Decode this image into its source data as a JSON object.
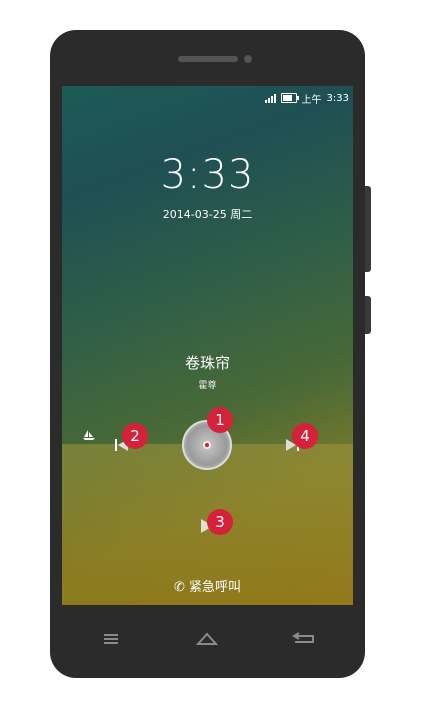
{
  "status_bar": {
    "time_period": "上午",
    "time": "3:33"
  },
  "lockscreen": {
    "clock": "3:33",
    "date": "2014-03-25 周二"
  },
  "music": {
    "title": "卷珠帘",
    "artist": "霍尊"
  },
  "badges": {
    "b1": "1",
    "b2": "2",
    "b3": "3",
    "b4": "4"
  },
  "emergency": {
    "label": "紧急呼叫"
  },
  "nav": {
    "menu_icon": "menu-icon",
    "home_icon": "home-icon",
    "back_icon": "back-icon"
  },
  "colors": {
    "badge": "#d5213a",
    "phone_body": "#2b2b2b"
  }
}
